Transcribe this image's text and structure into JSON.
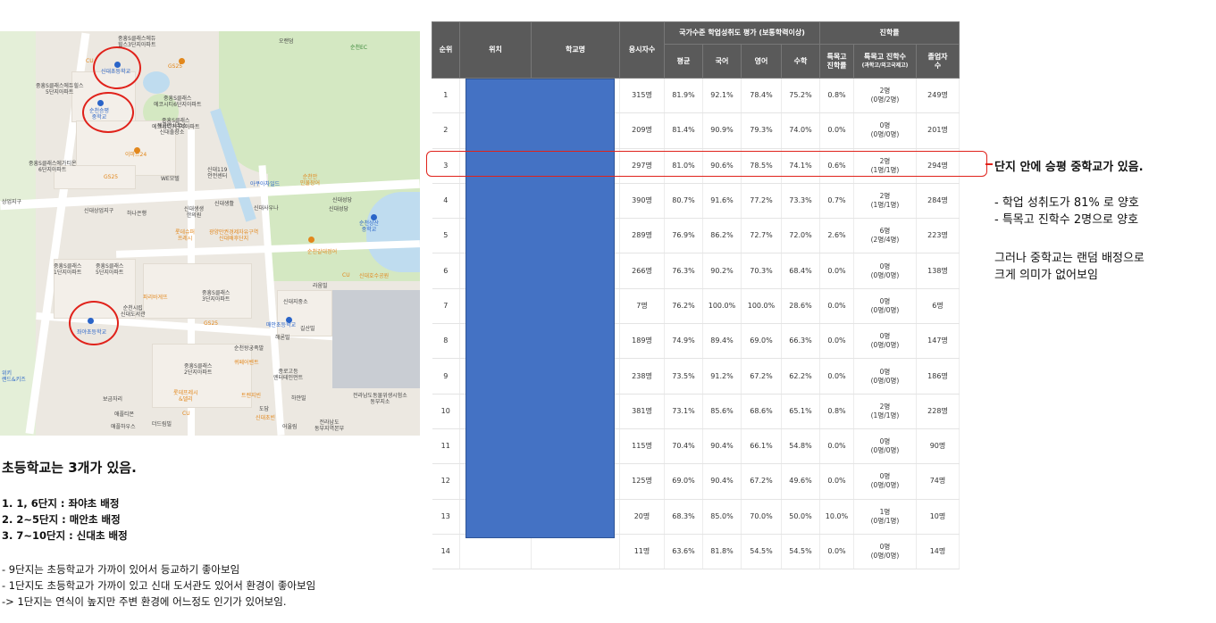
{
  "map": {
    "labels": [
      {
        "text": "중흥S클래스에듀\n힐스3단지아파트"
      },
      {
        "text": "신대초등학교"
      },
      {
        "text": "GS25"
      },
      {
        "text": "CU"
      },
      {
        "text": "중흥S클래스에듀힐스\n5단지아파트"
      },
      {
        "text": "순천승평\n중학교"
      },
      {
        "text": "중흥S클래스\n에코시티6단지아파트"
      },
      {
        "text": "중흥S클래스\n에코시티7단지아파트"
      },
      {
        "text": "해룡면사무소\n신대출장소"
      },
      {
        "text": "이마트24"
      },
      {
        "text": "중흥S클래스에가티온\n6단지아파트"
      },
      {
        "text": "GS25"
      },
      {
        "text": "WE모텔"
      },
      {
        "text": "신대119\n안전센터"
      },
      {
        "text": "아쿠아차일드"
      },
      {
        "text": "순천만\n민물장어"
      },
      {
        "text": "신대상업지구"
      },
      {
        "text": "하나은행"
      },
      {
        "text": "신대생생\n한의원"
      },
      {
        "text": "신대사우나"
      },
      {
        "text": "신대성당"
      },
      {
        "text": "롯데슈퍼\n프레시"
      },
      {
        "text": "광양만권경제자유구역\n신대배후단지"
      },
      {
        "text": "순천상산\n중학교"
      },
      {
        "text": "중흥S클래스\n1단지아파트"
      },
      {
        "text": "중흥S클래스\n5단지아파트"
      },
      {
        "text": "순천갈대정어"
      },
      {
        "text": "신대호수공원"
      },
      {
        "text": "라움빌"
      },
      {
        "text": "파리바게뜨"
      },
      {
        "text": "중흥S클래스\n3단지아파트"
      },
      {
        "text": "순천시립\n신대도서관"
      },
      {
        "text": "좌야초등학교"
      },
      {
        "text": "신대지중소"
      },
      {
        "text": "매안초등학교"
      },
      {
        "text": "길산빌"
      },
      {
        "text": "GS25"
      },
      {
        "text": "해론빌"
      },
      {
        "text": "순천왕궁족발"
      },
      {
        "text": "중흥S클래스\n2단지아파트"
      },
      {
        "text": "퀴페어벤트"
      },
      {
        "text": "종로고등\n엔터테인먼트"
      },
      {
        "text": "보금자리"
      },
      {
        "text": "롯데프레시\n&델리"
      },
      {
        "text": "트렌지빈"
      },
      {
        "text": "하얀빌"
      },
      {
        "text": "도담"
      },
      {
        "text": "신대초빈"
      },
      {
        "text": "전라남도동물위생시험소\n동부지소"
      },
      {
        "text": "애플티몬"
      },
      {
        "text": "애플하우스"
      },
      {
        "text": "더드림빌"
      },
      {
        "text": "CU"
      },
      {
        "text": "어울림"
      },
      {
        "text": "전라남도\n동부지역본부"
      },
      {
        "text": "오랜덤"
      },
      {
        "text": "순천EC"
      },
      {
        "text": "위키\n랜드&키즈"
      },
      {
        "text": "상업지구"
      },
      {
        "text": "신대생활"
      },
      {
        "text": "신대성당"
      },
      {
        "text": "CU"
      }
    ]
  },
  "table": {
    "headers": {
      "rank": "순위",
      "location": "위치",
      "school": "학교명",
      "applicants": "응시자수",
      "national_eval": "국가수준 학업성취도 평가 (보통학력이상)",
      "avg": "평균",
      "korean": "국어",
      "english": "영어",
      "math": "수학",
      "advancement": "진학률",
      "special_rate": "특목고\n진학률",
      "special_count": "특목고 진학수",
      "special_count_sub": "(과학고/외고국제고)",
      "graduates": "졸업자\n수"
    },
    "rows": [
      {
        "rank": "1",
        "applicants": "315명",
        "avg": "81.9%",
        "korean": "92.1%",
        "english": "78.4%",
        "math": "75.2%",
        "special_rate": "0.8%",
        "special_count": "2명",
        "special_detail": "(0명/2명)",
        "graduates": "249명"
      },
      {
        "rank": "2",
        "applicants": "209명",
        "avg": "81.4%",
        "korean": "90.9%",
        "english": "79.3%",
        "math": "74.0%",
        "special_rate": "0.0%",
        "special_count": "0명",
        "special_detail": "(0명/0명)",
        "graduates": "201명"
      },
      {
        "rank": "3",
        "applicants": "297명",
        "avg": "81.0%",
        "korean": "90.6%",
        "english": "78.5%",
        "math": "74.1%",
        "special_rate": "0.6%",
        "special_count": "2명",
        "special_detail": "(1명/1명)",
        "graduates": "294명"
      },
      {
        "rank": "4",
        "applicants": "390명",
        "avg": "80.7%",
        "korean": "91.6%",
        "english": "77.2%",
        "math": "73.3%",
        "special_rate": "0.7%",
        "special_count": "2명",
        "special_detail": "(1명/1명)",
        "graduates": "284명"
      },
      {
        "rank": "5",
        "applicants": "289명",
        "avg": "76.9%",
        "korean": "86.2%",
        "english": "72.7%",
        "math": "72.0%",
        "special_rate": "2.6%",
        "special_count": "6명",
        "special_detail": "(2명/4명)",
        "graduates": "223명"
      },
      {
        "rank": "6",
        "applicants": "266명",
        "avg": "76.3%",
        "korean": "90.2%",
        "english": "70.3%",
        "math": "68.4%",
        "special_rate": "0.0%",
        "special_count": "0명",
        "special_detail": "(0명/0명)",
        "graduates": "138명"
      },
      {
        "rank": "7",
        "applicants": "7명",
        "avg": "76.2%",
        "korean": "100.0%",
        "english": "100.0%",
        "math": "28.6%",
        "special_rate": "0.0%",
        "special_count": "0명",
        "special_detail": "(0명/0명)",
        "graduates": "6명"
      },
      {
        "rank": "8",
        "applicants": "189명",
        "avg": "74.9%",
        "korean": "89.4%",
        "english": "69.0%",
        "math": "66.3%",
        "special_rate": "0.0%",
        "special_count": "0명",
        "special_detail": "(0명/0명)",
        "graduates": "147명"
      },
      {
        "rank": "9",
        "applicants": "238명",
        "avg": "73.5%",
        "korean": "91.2%",
        "english": "67.2%",
        "math": "62.2%",
        "special_rate": "0.0%",
        "special_count": "0명",
        "special_detail": "(0명/0명)",
        "graduates": "186명"
      },
      {
        "rank": "10",
        "applicants": "381명",
        "avg": "73.1%",
        "korean": "85.6%",
        "english": "68.6%",
        "math": "65.1%",
        "special_rate": "0.8%",
        "special_count": "2명",
        "special_detail": "(1명/1명)",
        "graduates": "228명"
      },
      {
        "rank": "11",
        "applicants": "115명",
        "avg": "70.4%",
        "korean": "90.4%",
        "english": "66.1%",
        "math": "54.8%",
        "special_rate": "0.0%",
        "special_count": "0명",
        "special_detail": "(0명/0명)",
        "graduates": "90명"
      },
      {
        "rank": "12",
        "applicants": "125명",
        "avg": "69.0%",
        "korean": "90.4%",
        "english": "67.2%",
        "math": "49.6%",
        "special_rate": "0.0%",
        "special_count": "0명",
        "special_detail": "(0명/0명)",
        "graduates": "74명"
      },
      {
        "rank": "13",
        "applicants": "20명",
        "avg": "68.3%",
        "korean": "85.0%",
        "english": "70.0%",
        "math": "50.0%",
        "special_rate": "10.0%",
        "special_count": "1명",
        "special_detail": "(0명/1명)",
        "graduates": "10명"
      },
      {
        "rank": "14",
        "applicants": "11명",
        "avg": "63.6%",
        "korean": "81.8%",
        "english": "54.5%",
        "math": "54.5%",
        "special_rate": "0.0%",
        "special_count": "0명",
        "special_detail": "(0명/0명)",
        "graduates": "14명"
      }
    ]
  },
  "right_notes": {
    "title": "단지 안에 승평 중학교가 있음.",
    "bullets": [
      "- 학업 성취도가 81% 로 양호",
      "- 특목고 진학수 2명으로 양호"
    ],
    "conclusion": [
      "그러나 중학교는 랜덤 배정으로",
      "크게 의미가 없어보임"
    ]
  },
  "bottom_notes": {
    "title": "초등학교는 3개가 있음.",
    "assignments": [
      "1. 1, 6단지 : 좌야초 배정",
      "2. 2~5단지 : 매안초 배정",
      "3. 7~10단지 : 신대초 배정"
    ],
    "remarks": [
      "-   9단지는 초등학교가 가까이 있어서 등교하기 좋아보임",
      "-   1단지도 초등학교가 가까이 있고 신대 도서관도 있어서 환경이 좋아보임",
      "-> 1단지는 연식이 높지만 주변 환경에 어느정도 인기가 있어보임."
    ]
  },
  "colors": {
    "header_bg": "#5a5a5a",
    "mask_blue": "#4472c4",
    "highlight_red": "#e0221b",
    "park_green": "#d4e8c2",
    "water_blue": "#bfdcef"
  }
}
